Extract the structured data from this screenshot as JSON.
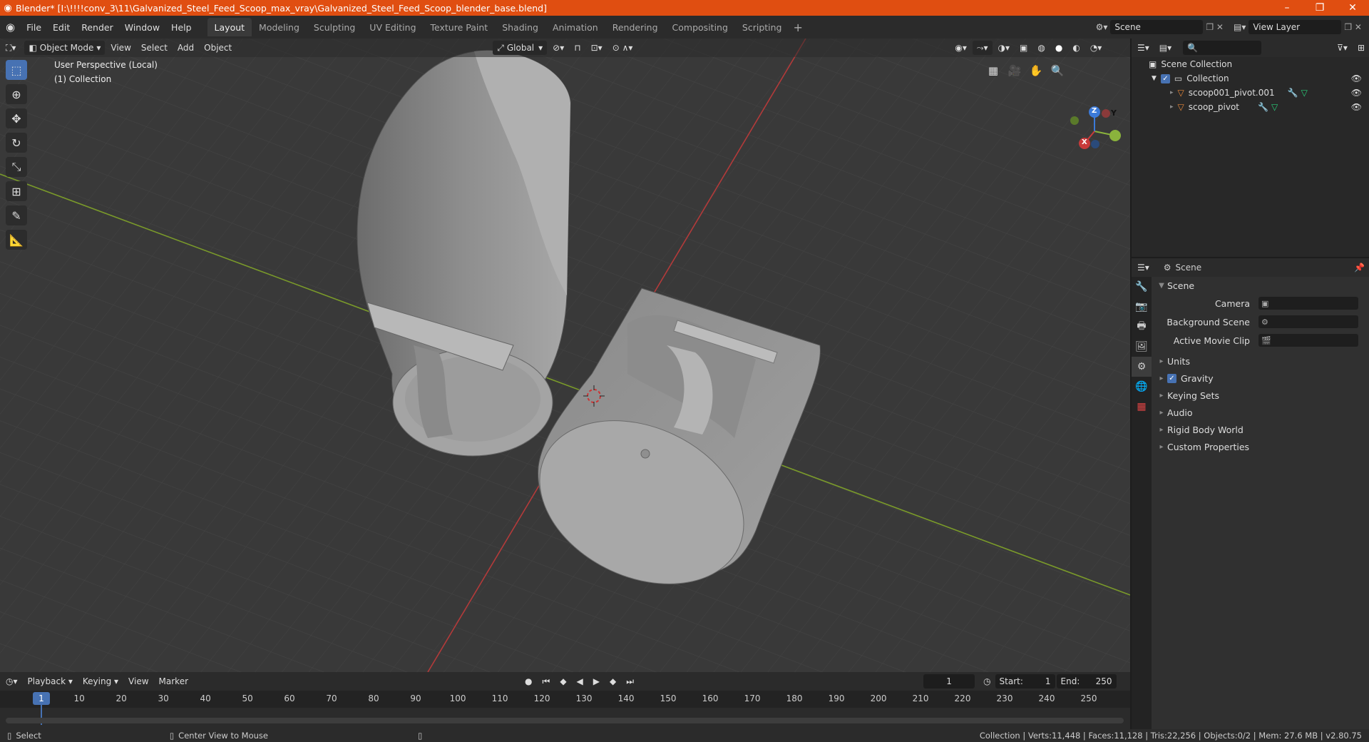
{
  "title": "Blender* [I:\\!!!!conv_3\\11\\Galvanized_Steel_Feed_Scoop_max_vray\\Galvanized_Steel_Feed_Scoop_blender_base.blend]",
  "window_controls": {
    "minimize": "–",
    "restore": "❐",
    "close": "✕"
  },
  "menu": [
    "File",
    "Edit",
    "Render",
    "Window",
    "Help"
  ],
  "workspace_tabs": [
    "Layout",
    "Modeling",
    "Sculpting",
    "UV Editing",
    "Texture Paint",
    "Shading",
    "Animation",
    "Rendering",
    "Compositing",
    "Scripting"
  ],
  "add_workspace": "+",
  "scene_name": "Scene",
  "view_layer": "View Layer",
  "viewport": {
    "mode": "Object Mode",
    "menus": [
      "View",
      "Select",
      "Add",
      "Object"
    ],
    "orientation": "Global",
    "info_line1": "User Perspective (Local)",
    "info_line2": "(1) Collection",
    "gizmo": {
      "x": "X",
      "y": "Y",
      "z": "Z"
    }
  },
  "outliner": {
    "search_placeholder": "",
    "root": "Scene Collection",
    "collection": "Collection",
    "objects": [
      "scoop001_pivot.001",
      "scoop_pivot"
    ]
  },
  "properties": {
    "header": "Scene",
    "panel": "Scene",
    "fields": [
      {
        "label": "Camera",
        "value": ""
      },
      {
        "label": "Background Scene",
        "value": ""
      },
      {
        "label": "Active Movie Clip",
        "value": ""
      }
    ],
    "subpanels": [
      "Units",
      "Gravity",
      "Keying Sets",
      "Audio",
      "Rigid Body World",
      "Custom Properties"
    ],
    "gravity_checked": true
  },
  "timeline": {
    "menus": [
      "Playback",
      "Keying",
      "View",
      "Marker"
    ],
    "current_frame": "1",
    "start_label": "Start:",
    "start": "1",
    "end_label": "End:",
    "end": "250",
    "ticks": [
      "1",
      "10",
      "20",
      "30",
      "40",
      "50",
      "60",
      "70",
      "80",
      "90",
      "100",
      "110",
      "120",
      "130",
      "140",
      "150",
      "160",
      "170",
      "180",
      "190",
      "200",
      "210",
      "220",
      "230",
      "240",
      "250"
    ]
  },
  "status": {
    "left": "Select",
    "middle": "Center View to Mouse",
    "right": "Collection | Verts:11,448 | Faces:11,128 | Tris:22,256 | Objects:0/2 | Mem: 27.6 MB | v2.80.75"
  },
  "colors": {
    "title_bar": "#e04e11",
    "accent": "#4772b3",
    "viewport_bg": "#393939",
    "x_axis": "#c83a3a",
    "y_axis": "#8ab33c",
    "object": "#9a9a9a"
  }
}
